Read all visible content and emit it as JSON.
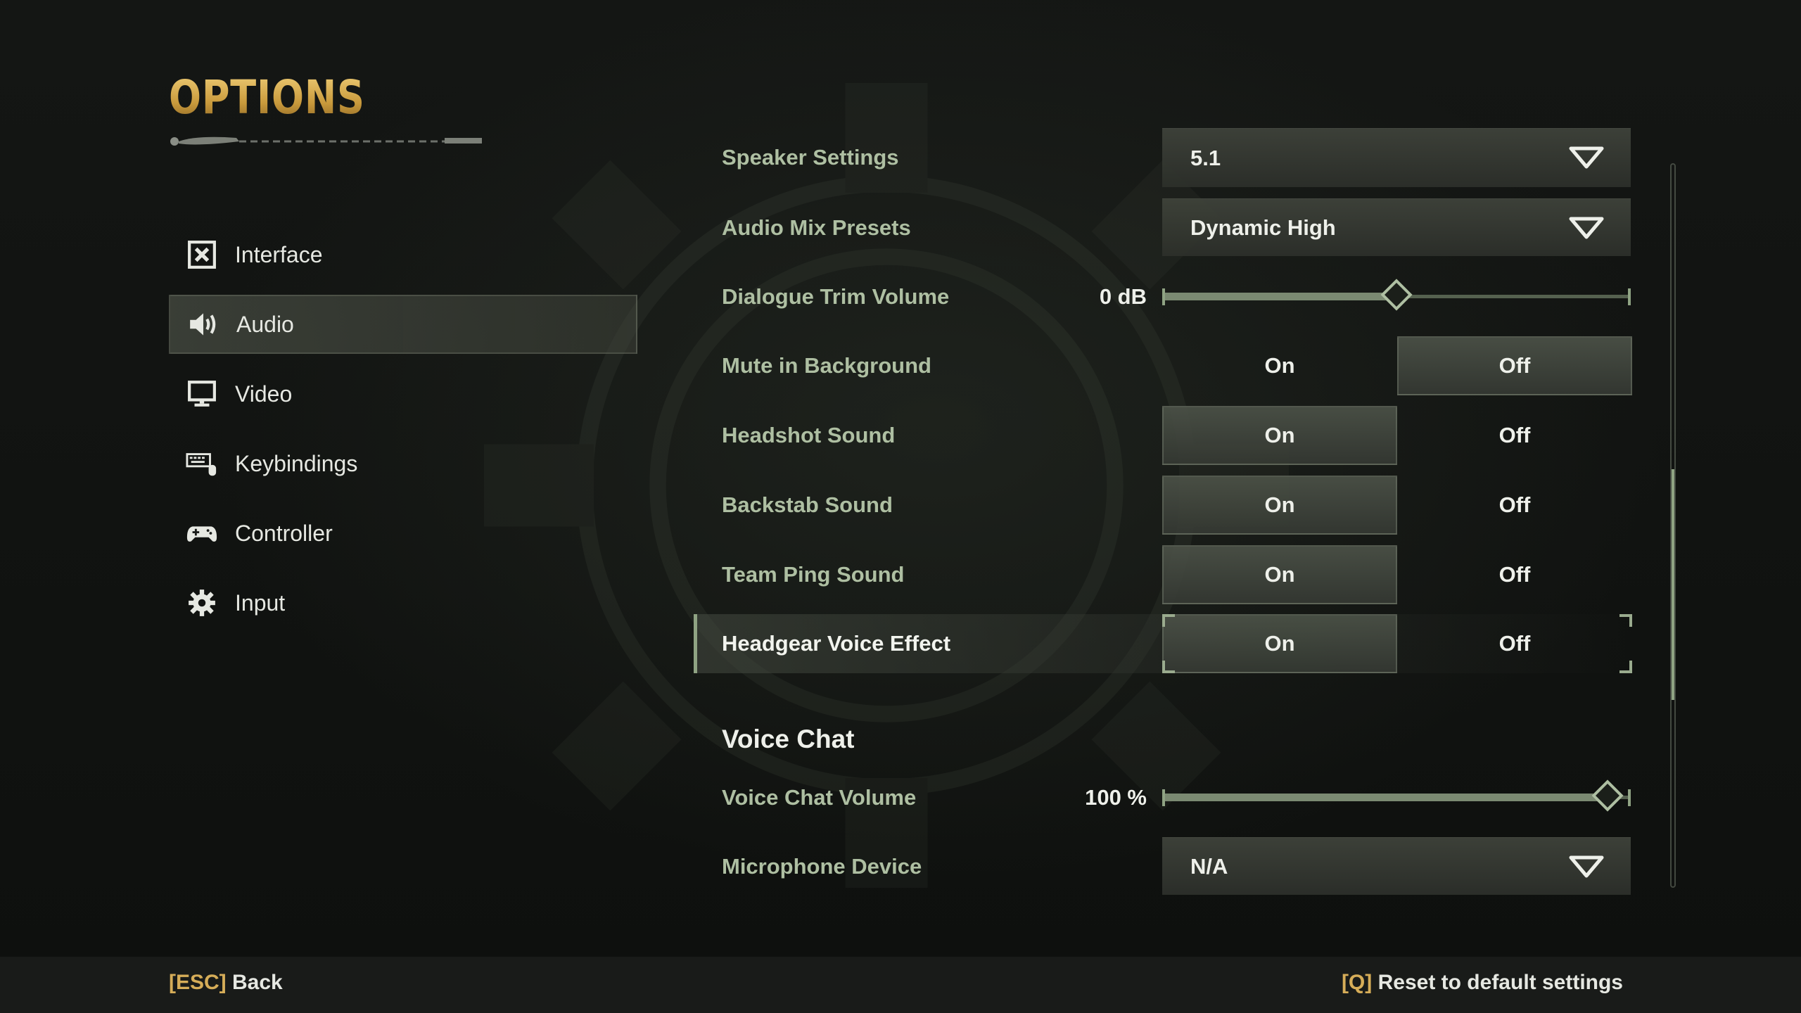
{
  "header": {
    "title": "OPTIONS"
  },
  "nav": {
    "items": [
      {
        "label": "Interface",
        "icon": "interface-icon",
        "active": false
      },
      {
        "label": "Audio",
        "icon": "speaker-icon",
        "active": true
      },
      {
        "label": "Video",
        "icon": "monitor-icon",
        "active": false
      },
      {
        "label": "Keybindings",
        "icon": "keyboard-mouse-icon",
        "active": false
      },
      {
        "label": "Controller",
        "icon": "gamepad-icon",
        "active": false
      },
      {
        "label": "Input",
        "icon": "gear-icon",
        "active": false
      }
    ]
  },
  "settings": {
    "speaker_settings": {
      "label": "Speaker Settings",
      "value": "5.1"
    },
    "audio_mix_presets": {
      "label": "Audio Mix Presets",
      "value": "Dynamic High"
    },
    "dialogue_trim_volume": {
      "label": "Dialogue Trim Volume",
      "value_text": "0 dB",
      "level": 0.5
    },
    "mute_in_background": {
      "label": "Mute in Background",
      "on_label": "On",
      "off_label": "Off",
      "selected": "Off"
    },
    "headshot_sound": {
      "label": "Headshot Sound",
      "on_label": "On",
      "off_label": "Off",
      "selected": "On"
    },
    "backstab_sound": {
      "label": "Backstab Sound",
      "on_label": "On",
      "off_label": "Off",
      "selected": "On"
    },
    "team_ping_sound": {
      "label": "Team Ping Sound",
      "on_label": "On",
      "off_label": "Off",
      "selected": "On"
    },
    "headgear_voice_effect": {
      "label": "Headgear Voice Effect",
      "on_label": "On",
      "off_label": "Off",
      "selected": "On",
      "focused": true
    },
    "voice_chat_section": {
      "title": "Voice Chat"
    },
    "voice_chat_volume": {
      "label": "Voice Chat Volume",
      "value_text": "100 %",
      "level": 0.95
    },
    "microphone_device": {
      "label": "Microphone Device",
      "value": "N/A"
    }
  },
  "scroll": {
    "position": 0.62,
    "visible_fraction": 0.32
  },
  "footer": {
    "back_key": "[ESC]",
    "back_label": "Back",
    "reset_key": "[Q]",
    "reset_label": "Reset to default settings"
  },
  "colors": {
    "accent_gold": "#d6ad58",
    "label_green": "#aebfa2",
    "slider_green": "#8fa383",
    "background": "#0f110f"
  }
}
